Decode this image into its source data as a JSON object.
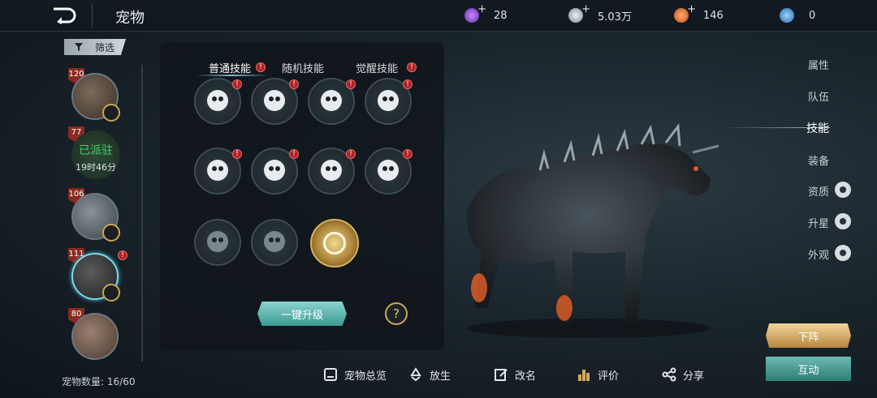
{
  "header": {
    "title": "宠物",
    "resources": [
      {
        "icon": "purple-orb-icon",
        "value": "28",
        "plus": true,
        "color": "#8a48c8"
      },
      {
        "icon": "silver-coin-icon",
        "value": "5.03万",
        "plus": true,
        "color": "#a8b0b8"
      },
      {
        "icon": "orange-gem-icon",
        "value": "146",
        "plus": true,
        "color": "#e06a2a"
      },
      {
        "icon": "blue-crystal-icon",
        "value": "0",
        "plus": false,
        "color": "#4a9ad8"
      }
    ]
  },
  "sidebar": {
    "filter_label": "筛选",
    "pets": [
      {
        "level": "120",
        "kind": "horse"
      },
      {
        "level": "77",
        "status": "已派驻",
        "timer": "19时46分"
      },
      {
        "level": "106",
        "kind": "golem"
      },
      {
        "level": "111",
        "kind": "dark-horse",
        "selected": true,
        "alert": "!"
      },
      {
        "level": "80",
        "kind": "beast"
      }
    ],
    "count_label": "宠物数量:",
    "count_value": "16/60"
  },
  "skills": {
    "tabs": [
      {
        "label": "普通技能",
        "alert": "!"
      },
      {
        "label": "随机技能"
      },
      {
        "label": "觉醒技能",
        "alert": "!"
      }
    ],
    "slot_alert": "!",
    "upgrade_label": "一键升级",
    "help_label": "?"
  },
  "right_menu": [
    {
      "label": "属性"
    },
    {
      "label": "队伍"
    },
    {
      "label": "技能"
    },
    {
      "label": "装备"
    },
    {
      "label": "资质"
    },
    {
      "label": "升星"
    },
    {
      "label": "外观"
    }
  ],
  "actions": {
    "down_label": "下阵",
    "interact_label": "互动"
  },
  "bottom_bar": [
    {
      "label": "宠物总览",
      "icon": "book-icon"
    },
    {
      "label": "放生",
      "icon": "recycle-icon"
    },
    {
      "label": "改名",
      "icon": "edit-icon"
    },
    {
      "label": "评价",
      "icon": "bar-chart-icon"
    },
    {
      "label": "分享",
      "icon": "share-icon"
    }
  ]
}
